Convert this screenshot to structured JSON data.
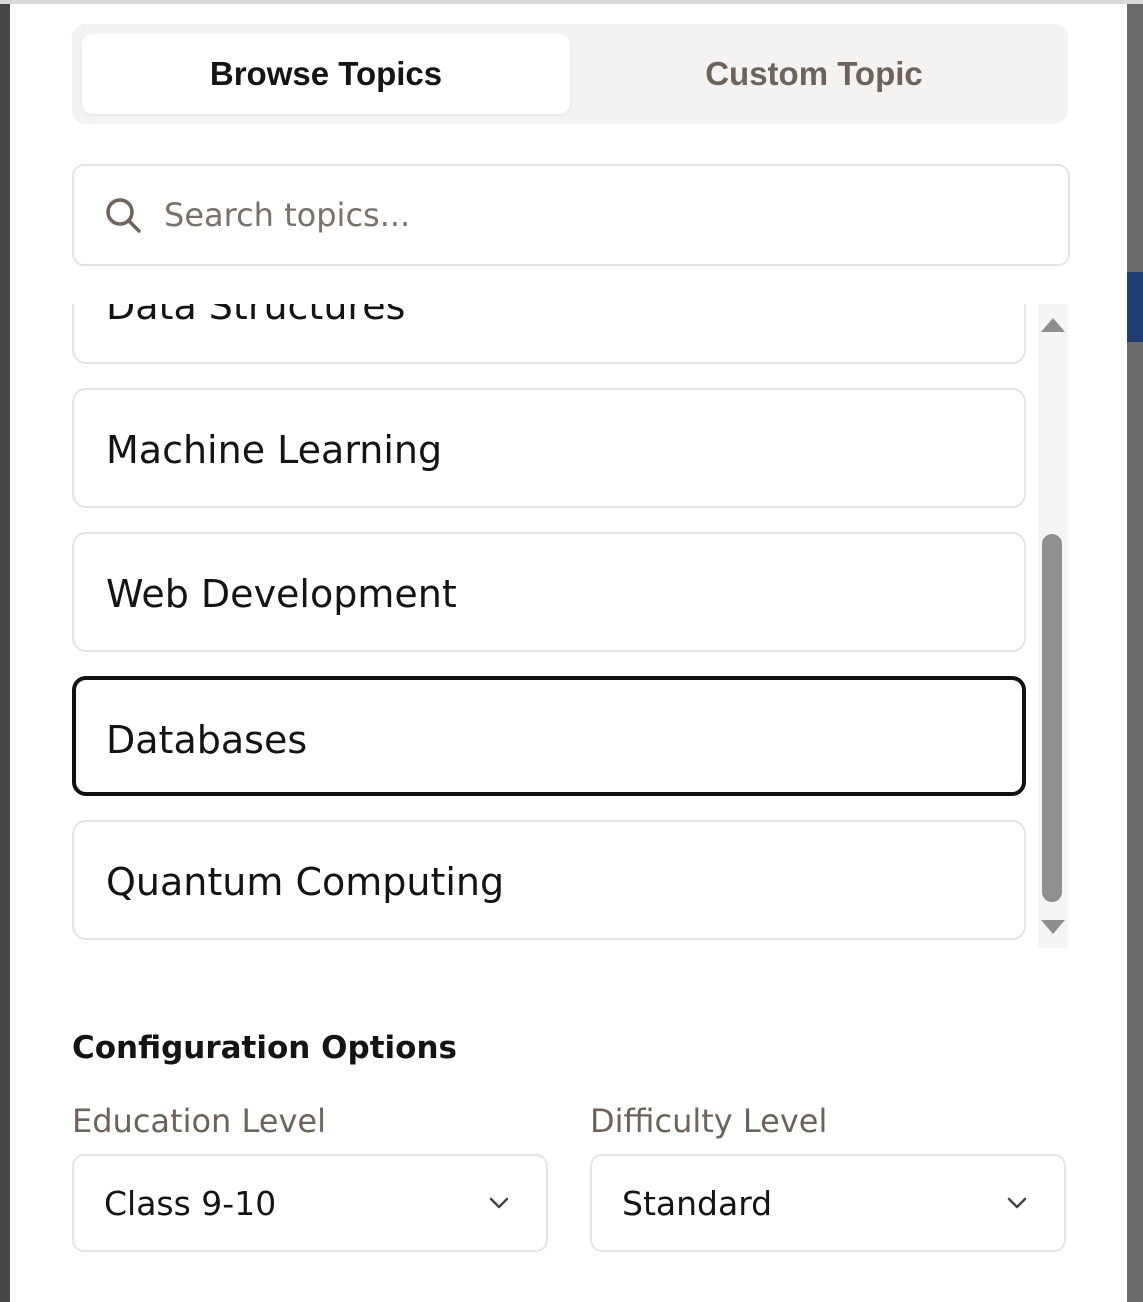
{
  "tabs": {
    "browse_label": "Browse Topics",
    "custom_label": "Custom Topic",
    "active": "Browse Topics"
  },
  "search": {
    "placeholder": "Search topics...",
    "value": ""
  },
  "topics": {
    "items": [
      {
        "label": "Data Structures"
      },
      {
        "label": "Machine Learning"
      },
      {
        "label": "Web Development"
      },
      {
        "label": "Databases"
      },
      {
        "label": "Quantum Computing"
      }
    ],
    "selected": "Databases"
  },
  "config": {
    "title": "Configuration Options",
    "education_label": "Education Level",
    "education_value": "Class 9-10",
    "difficulty_label": "Difficulty Level",
    "difficulty_value": "Standard"
  },
  "icons": {
    "search": "search-icon",
    "dropdown": "chevron-down-icon"
  }
}
